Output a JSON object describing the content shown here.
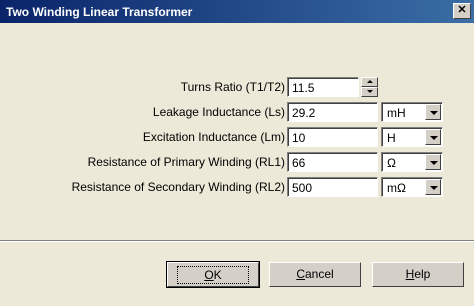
{
  "window": {
    "title": "Two Winding Linear Transformer",
    "close_glyph": "✕"
  },
  "fields": {
    "turns_ratio": {
      "label": "Turns Ratio (T1/T2)",
      "value": "11.5"
    },
    "leakage": {
      "label": "Leakage Inductance (Ls)",
      "value": "29.2",
      "unit": "mH"
    },
    "excitation": {
      "label": "Excitation Inductance (Lm)",
      "value": "10",
      "unit": "H"
    },
    "rl1": {
      "label": "Resistance of Primary Winding (RL1)",
      "value": "66",
      "unit": "Ω"
    },
    "rl2": {
      "label": "Resistance of Secondary Winding (RL2)",
      "value": "500",
      "unit": "mΩ"
    }
  },
  "buttons": {
    "ok": {
      "mnemonic": "O",
      "rest": "K"
    },
    "cancel": {
      "mnemonic": "C",
      "rest": "ancel"
    },
    "help": {
      "mnemonic": "H",
      "rest": "elp"
    }
  }
}
